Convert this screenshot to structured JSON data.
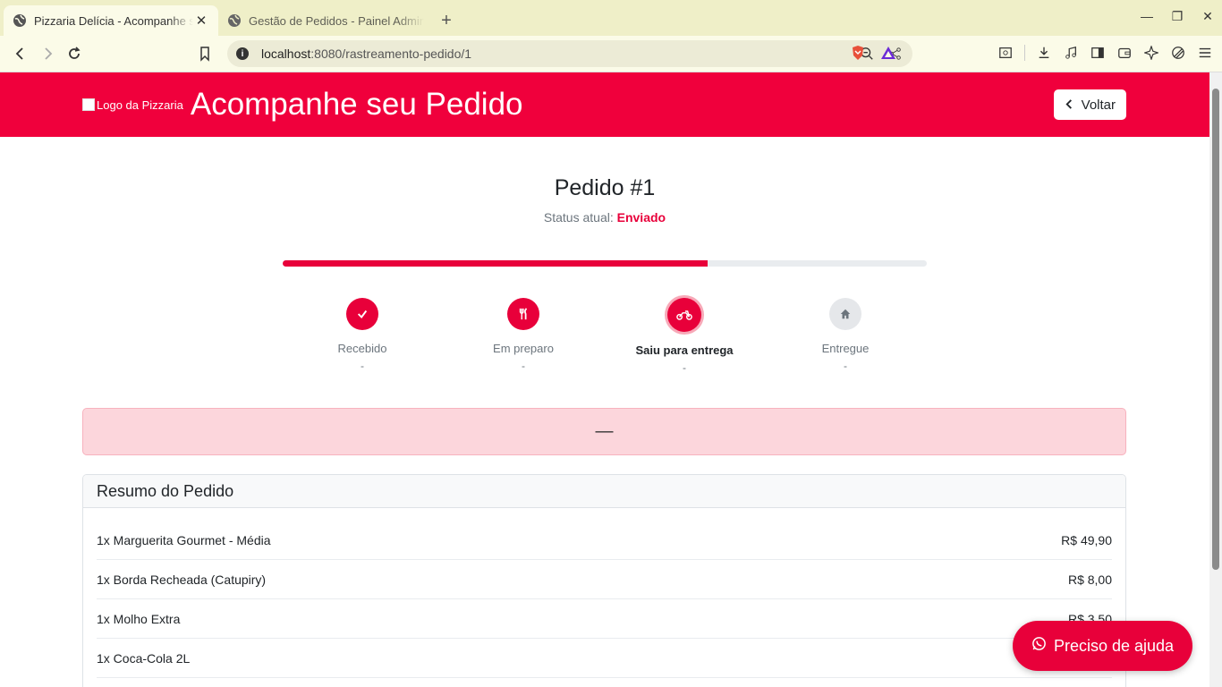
{
  "browser": {
    "tabs": [
      {
        "title": "Pizzaria Delícia - Acompanhe s",
        "active": true
      },
      {
        "title": "Gestão de Pedidos - Painel Admin",
        "active": false
      }
    ],
    "url_host": "localhost",
    "url_path": ":8080/rastreamento-pedido/1"
  },
  "header": {
    "logo_alt": "Logo da Pizzaria",
    "title": "Acompanhe seu Pedido",
    "back_label": "Voltar"
  },
  "order": {
    "title": "Pedido #1",
    "status_label": "Status atual:",
    "status_value": "Enviado",
    "progress": 0.66
  },
  "steps": [
    {
      "label": "Recebido",
      "time": "-",
      "state": "done",
      "icon": "check-icon"
    },
    {
      "label": "Em preparo",
      "time": "-",
      "state": "done",
      "icon": "utensils-icon"
    },
    {
      "label": "Saiu para entrega",
      "time": "-",
      "state": "current",
      "icon": "motorcycle-icon"
    },
    {
      "label": "Entregue",
      "time": "-",
      "state": "pending",
      "icon": "home-icon"
    }
  ],
  "alert": {
    "text": "—"
  },
  "summary": {
    "title": "Resumo do Pedido",
    "items": [
      {
        "name": "1x Marguerita Gourmet - Média",
        "price": "R$ 49,90"
      },
      {
        "name": "1x Borda Recheada (Catupiry)",
        "price": "R$ 8,00"
      },
      {
        "name": "1x Molho Extra",
        "price": "R$ 3,50"
      },
      {
        "name": "1x Coca-Cola 2L",
        "price": ""
      }
    ]
  },
  "help": {
    "label": "Preciso de ajuda"
  },
  "colors": {
    "brand": "#f0003c",
    "accent": "#e8003a"
  }
}
